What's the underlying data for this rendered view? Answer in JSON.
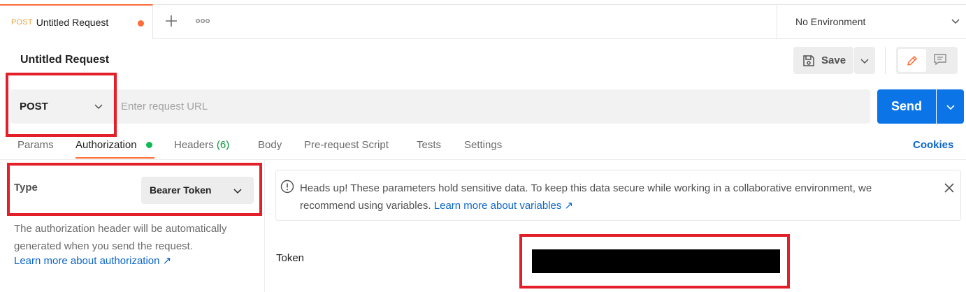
{
  "tab": {
    "method": "POST",
    "title": "Untitled Request"
  },
  "environment": {
    "selected": "No Environment"
  },
  "header": {
    "title": "Untitled Request",
    "save_label": "Save"
  },
  "request": {
    "method": "POST",
    "url_placeholder": "Enter request URL",
    "url_value": "",
    "send_label": "Send"
  },
  "subtabs": {
    "params": "Params",
    "authorization": "Authorization",
    "headers": "Headers",
    "headers_count": "(6)",
    "body": "Body",
    "prerequest": "Pre-request Script",
    "tests": "Tests",
    "settings": "Settings",
    "cookies": "Cookies"
  },
  "auth": {
    "type_label": "Type",
    "type_value": "Bearer Token",
    "help_text": "The authorization header will be automatically generated when you send the request.",
    "help_link": "Learn more about authorization ↗"
  },
  "notice": {
    "text": "Heads up! These parameters hold sensitive data. To keep this data secure while working in a collaborative environment, we recommend using variables. ",
    "link": "Learn more about variables ↗"
  },
  "token": {
    "label": "Token",
    "value": ""
  },
  "colors": {
    "accent": "#ff6c37",
    "primary": "#0b75e8",
    "link": "#0b66c9",
    "success": "#0cbb52",
    "highlight": "#e3202a"
  },
  "icons": [
    "plus-icon",
    "more-icon",
    "chevron-down-icon",
    "save-icon",
    "pencil-icon",
    "comment-icon",
    "info-icon",
    "close-icon"
  ]
}
